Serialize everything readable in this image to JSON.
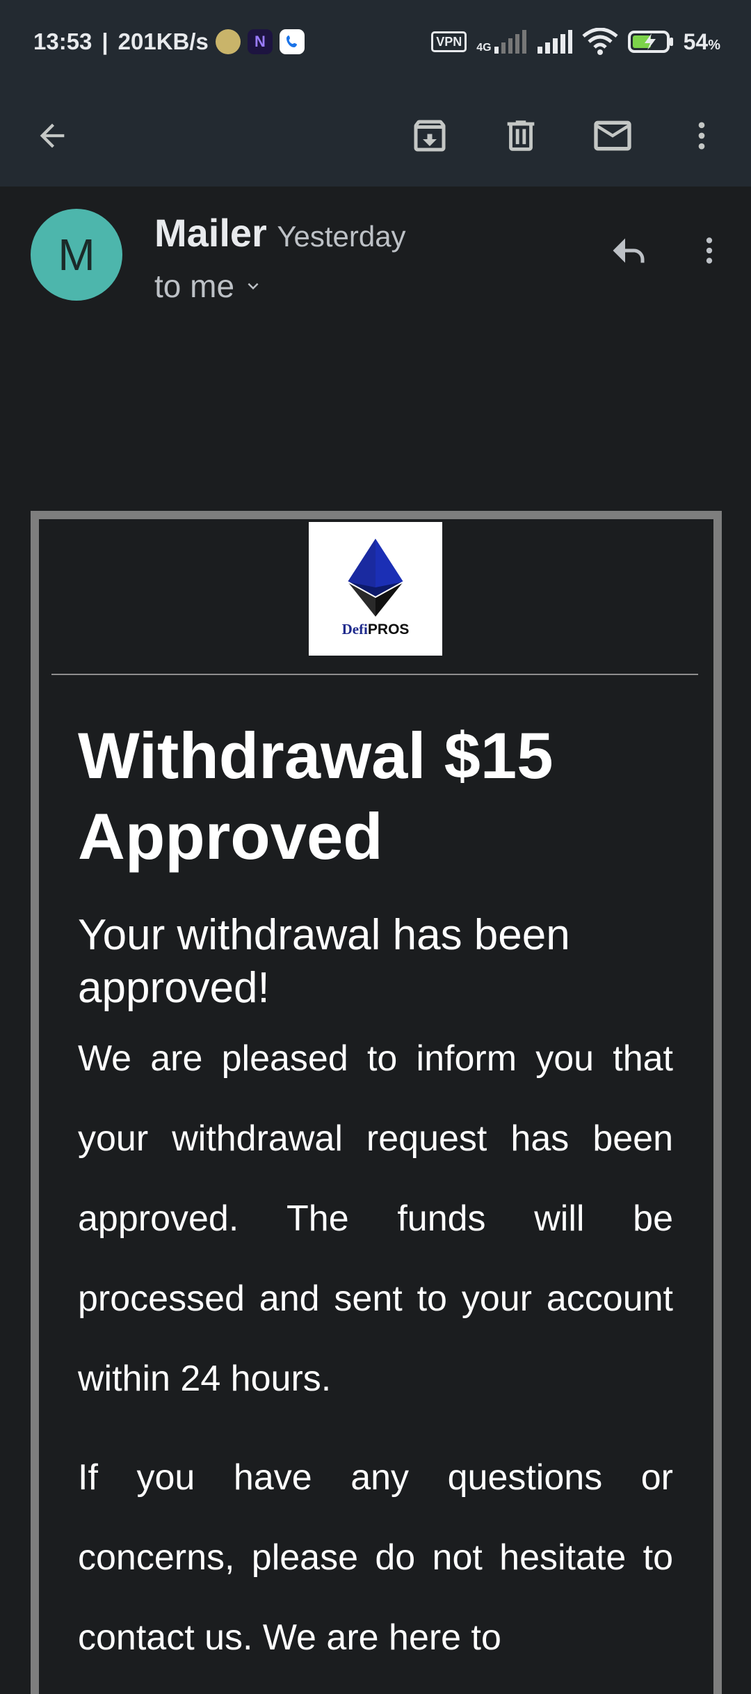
{
  "status_bar": {
    "time": "13:53",
    "separator": "|",
    "net_speed": "201KB/s",
    "vpn": "VPN",
    "network_type": "4G",
    "battery_percent": "54",
    "battery_unit": "%"
  },
  "toolbar": {
    "back_icon": "arrow-left-icon",
    "archive_icon": "archive-icon",
    "delete_icon": "trash-icon",
    "mark_unread_icon": "mail-icon",
    "more_icon": "more-vert-icon"
  },
  "message_header": {
    "avatar_letter": "M",
    "avatar_color": "#4db6ac",
    "sender": "Mailer",
    "date": "Yesterday",
    "recipient": "to me"
  },
  "email_body": {
    "logo": {
      "text_defi": "Defi",
      "text_pros": "PROS"
    },
    "headline": "Withdrawal $15 Approved",
    "subheadline": "Your withdrawal has been approved!",
    "paragraph_1": "We are pleased to inform you that your withdrawal request has been approved. The funds will be processed and sent to your account within 24 hours.",
    "paragraph_2": "If you have any questions or concerns, please do not hesitate to contact us. We are here to"
  },
  "colors": {
    "background": "#1b1d1f",
    "bar": "#232a31",
    "card_border": "#7e7e7e"
  }
}
